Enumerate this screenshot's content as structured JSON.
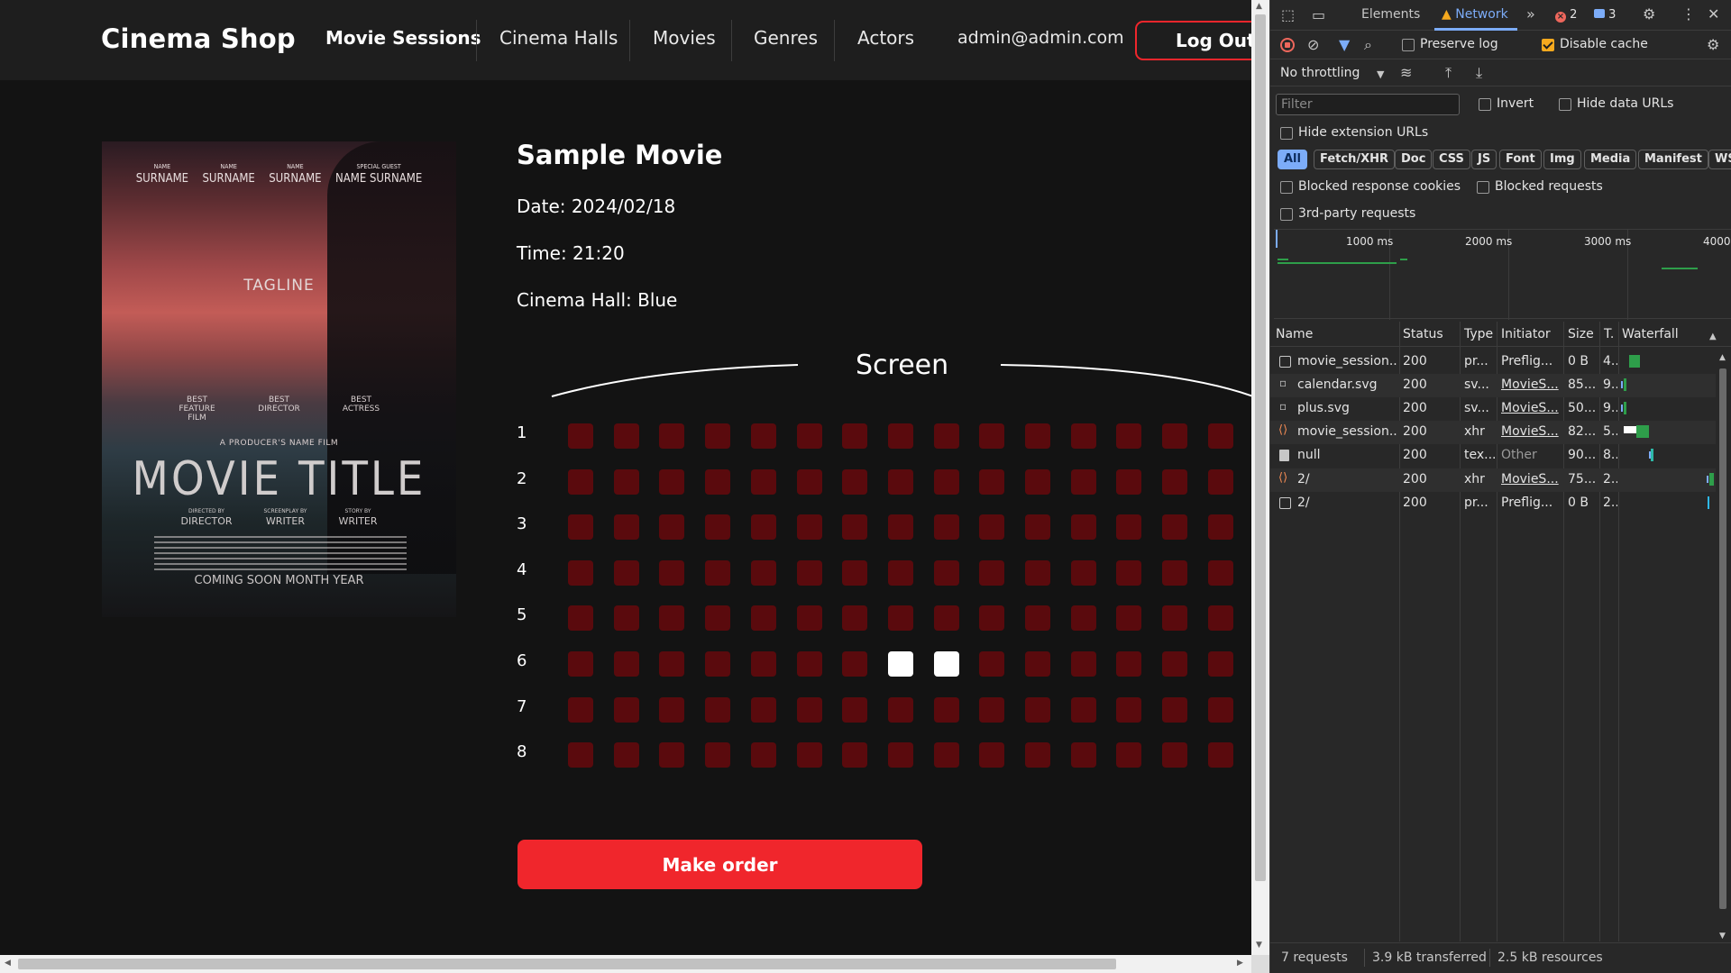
{
  "app": {
    "brand": "Cinema Shop",
    "nav": [
      "Movie Sessions",
      "Cinema Halls",
      "Movies",
      "Genres",
      "Actors"
    ],
    "user_email": "admin@admin.com",
    "logout_label": "Log Out",
    "colors": {
      "accent": "#f0262c",
      "seat": "#5a0a0d",
      "seat_selected": "#ffffff",
      "background": "#131313",
      "navbar": "#1e1e1e"
    }
  },
  "poster": {
    "credits": [
      {
        "top": "NAME",
        "name": "SURNAME"
      },
      {
        "top": "NAME",
        "name": "SURNAME"
      },
      {
        "top": "NAME",
        "name": "SURNAME"
      },
      {
        "top": "SPECIAL GUEST",
        "name": "NAME SURNAME"
      }
    ],
    "tagline": "TAGLINE",
    "laurels": [
      "BEST FEATURE FILM",
      "BEST DIRECTOR",
      "BEST ACTRESS"
    ],
    "producer": "A PRODUCER'S NAME FILM",
    "title": "MOVIE TITLE",
    "roles": [
      {
        "top": "DIRECTED BY",
        "name": "DIRECTOR"
      },
      {
        "top": "SCREENPLAY BY",
        "name": "WRITER"
      },
      {
        "top": "STORY BY",
        "name": "WRITER"
      }
    ],
    "coming": "COMING SOON    MONTH YEAR"
  },
  "session": {
    "title": "Sample Movie",
    "date": "Date: 2024/02/18",
    "time": "Time: 21:20",
    "hall": "Cinema Hall: Blue",
    "screen_label": "Screen",
    "rows": [
      "1",
      "2",
      "3",
      "4",
      "5",
      "6",
      "7",
      "8"
    ],
    "seats_per_row": 15,
    "selected_seats": [
      [
        6,
        8
      ],
      [
        6,
        9
      ]
    ],
    "order_button": "Make order"
  },
  "devtools": {
    "tabs": [
      "Elements",
      "Network"
    ],
    "active_tab": "Network",
    "error_count": "2",
    "message_count": "3",
    "preserve_log": "Preserve log",
    "disable_cache": "Disable cache",
    "throttling": "No throttling",
    "filter_placeholder": "Filter",
    "invert": "Invert",
    "hide_data_urls": "Hide data URLs",
    "hide_extension_urls": "Hide extension URLs",
    "type_filters": [
      "All",
      "Fetch/XHR",
      "Doc",
      "CSS",
      "JS",
      "Font",
      "Img",
      "Media",
      "Manifest",
      "WS"
    ],
    "blocked_response_cookies": "Blocked response cookies",
    "blocked_requests": "Blocked requests",
    "third_party": "3rd-party requests",
    "timeline_labels": [
      "1000 ms",
      "2000 ms",
      "3000 ms",
      "4000"
    ],
    "columns": [
      "Name",
      "Status",
      "Type",
      "Initiator",
      "Size",
      "T.",
      "Waterfall"
    ],
    "requests": [
      {
        "name": "movie_session...",
        "status": "200",
        "type": "pr...",
        "initiator": "Preflig...",
        "size": "0 B",
        "time": "4..",
        "icon": "box"
      },
      {
        "name": "calendar.svg",
        "status": "200",
        "type": "sv...",
        "initiator": "MovieS...",
        "size": "85...",
        "time": "9..",
        "icon": "svg"
      },
      {
        "name": "plus.svg",
        "status": "200",
        "type": "sv...",
        "initiator": "MovieS...",
        "size": "50...",
        "time": "9..",
        "icon": "svg"
      },
      {
        "name": "movie_session...",
        "status": "200",
        "type": "xhr",
        "initiator": "MovieS...",
        "size": "82...",
        "time": "5..",
        "icon": "xhr"
      },
      {
        "name": "null",
        "status": "200",
        "type": "tex...",
        "initiator": "Other",
        "size": "90...",
        "time": "8..",
        "icon": "doc"
      },
      {
        "name": "2/",
        "status": "200",
        "type": "xhr",
        "initiator": "MovieS...",
        "size": "75...",
        "time": "2..",
        "icon": "xhr"
      },
      {
        "name": "2/",
        "status": "200",
        "type": "pr...",
        "initiator": "Preflig...",
        "size": "0 B",
        "time": "2..",
        "icon": "box"
      }
    ],
    "status": {
      "requests": "7 requests",
      "transferred": "3.9 kB transferred",
      "resources": "2.5 kB resources"
    }
  }
}
